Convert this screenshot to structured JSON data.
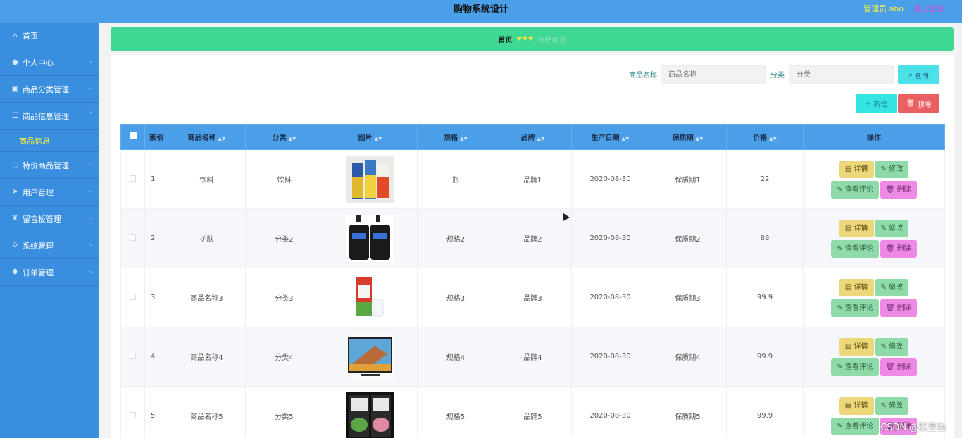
{
  "header": {
    "title": "购物系统设计",
    "admin": "管理员 abo",
    "logout": "退出登录"
  },
  "sidebar": {
    "items": [
      {
        "label": "首页",
        "icon": "home-icon"
      },
      {
        "label": "个人中心",
        "icon": "user-icon"
      },
      {
        "label": "商品分类管理",
        "icon": "calendar-icon"
      },
      {
        "label": "商品信息管理",
        "icon": "list-icon"
      },
      {
        "label": "商品信息",
        "sub": true
      },
      {
        "label": "特价商品管理",
        "icon": "clock-icon"
      },
      {
        "label": "用户管理",
        "icon": "send-icon"
      },
      {
        "label": "留言板管理",
        "icon": "trophy-icon"
      },
      {
        "label": "系统管理",
        "icon": "mic-icon"
      },
      {
        "label": "订单管理",
        "icon": "pin-icon"
      }
    ]
  },
  "breadcrumb": {
    "home": "首页",
    "current": "商品信息"
  },
  "search": {
    "name_label": "商品名称",
    "name_placeholder": "商品名称",
    "category_label": "分类",
    "category_placeholder": "分类",
    "query_label": "查询"
  },
  "toolbar": {
    "add_label": "新增",
    "delete_label": "删除"
  },
  "table": {
    "headers": [
      "索引",
      "商品名称",
      "分类",
      "图片",
      "规格",
      "品牌",
      "生产日期",
      "保质期",
      "价格",
      "操作"
    ],
    "rows": [
      {
        "index": "1",
        "name": "饮料",
        "category": "饮料",
        "spec": "瓶",
        "brand": "品牌1",
        "date": "2020-08-30",
        "shelf": "保质期1",
        "price": "22",
        "image": "drink-cartons-image"
      },
      {
        "index": "2",
        "name": "护肤",
        "category": "分类2",
        "spec": "规格2",
        "brand": "品牌2",
        "date": "2020-08-30",
        "shelf": "保质期2",
        "price": "88",
        "image": "skincare-bottles-image"
      },
      {
        "index": "3",
        "name": "商品名称3",
        "category": "分类3",
        "spec": "规格3",
        "brand": "品牌3",
        "date": "2020-08-30",
        "shelf": "保质期3",
        "price": "99.9",
        "image": "milk-carton-image"
      },
      {
        "index": "4",
        "name": "商品名称4",
        "category": "分类4",
        "spec": "规格4",
        "brand": "品牌4",
        "date": "2020-08-30",
        "shelf": "保质期4",
        "price": "99.9",
        "image": "television-image"
      },
      {
        "index": "5",
        "name": "商品名称5",
        "category": "分类5",
        "spec": "规格5",
        "brand": "品牌5",
        "date": "2020-08-30",
        "shelf": "保质期5",
        "price": "99.9",
        "image": "tea-packages-image"
      }
    ],
    "actions": {
      "detail": "详情",
      "edit": "修改",
      "comment": "查看评论",
      "remove": "删除"
    }
  },
  "watermark": "CSDN @栗豆包"
}
